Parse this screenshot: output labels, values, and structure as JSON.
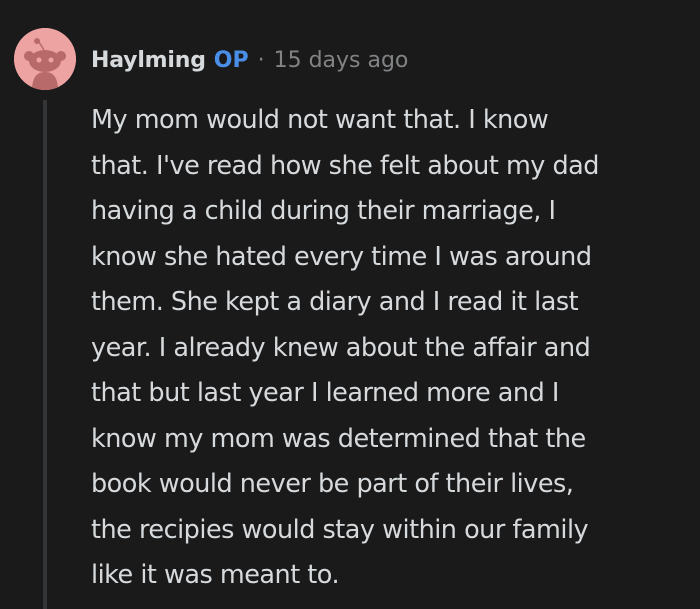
{
  "comment": {
    "username": "Haylming",
    "op_badge": "OP",
    "separator": "·",
    "timestamp": "15 days ago",
    "avatar_icon": "reddit-snoo-avatar-icon",
    "body_lines": [
      "My mom would not want that. I know",
      "that. I've read how she felt about my dad",
      "having a child during their marriage, I",
      "know she hated every time I was around",
      "them. She kept a diary and I read it last",
      "year. I already knew about the affair and",
      "that but last year I learned more and I",
      "know my mom was determined that the",
      "book would never be part of their lives,",
      "the recipies would stay within our family",
      "like it was meant to."
    ]
  },
  "colors": {
    "background": "#1a1a1b",
    "text": "#d7dadc",
    "meta_text": "#818384",
    "op_badge": "#4a8fe7",
    "avatar_bg": "#eea3a3",
    "thread_line": "#343536"
  }
}
